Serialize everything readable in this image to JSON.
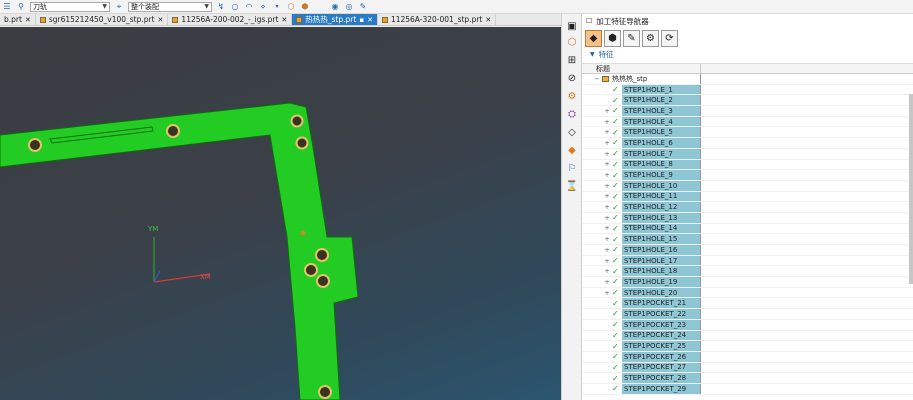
{
  "toolbar": {
    "filter_select": "刀轨",
    "assembly_select": "整个装配"
  },
  "tabs": [
    {
      "label": "b.prt",
      "active": false
    },
    {
      "label": "sgr615212450_v100_stp.prt",
      "active": false
    },
    {
      "label": "11256A-200-002_-_igs.prt",
      "active": false
    },
    {
      "label": "热热热_stp.prt",
      "active": true
    },
    {
      "label": "11256A-320-001_stp.prt",
      "active": false
    }
  ],
  "viewport": {
    "axis_y": "YM",
    "axis_x": "XM",
    "part_color": "#22cc22"
  },
  "navigator": {
    "title": "加工特征导航器",
    "section": "特征",
    "column_name": "标题",
    "root": "热热热_stp",
    "accent": "#8fc6d6",
    "items": [
      {
        "label": "STEP1HOLE_1",
        "expander": ""
      },
      {
        "label": "STEP1HOLE_2",
        "expander": ""
      },
      {
        "label": "STEP1HOLE_3",
        "expander": "+"
      },
      {
        "label": "STEP1HOLE_4",
        "expander": "+"
      },
      {
        "label": "STEP1HOLE_5",
        "expander": "+"
      },
      {
        "label": "STEP1HOLE_6",
        "expander": "+"
      },
      {
        "label": "STEP1HOLE_7",
        "expander": "+"
      },
      {
        "label": "STEP1HOLE_8",
        "expander": "+"
      },
      {
        "label": "STEP1HOLE_9",
        "expander": "+"
      },
      {
        "label": "STEP1HOLE_10",
        "expander": "+"
      },
      {
        "label": "STEP1HOLE_11",
        "expander": "+"
      },
      {
        "label": "STEP1HOLE_12",
        "expander": "+"
      },
      {
        "label": "STEP1HOLE_13",
        "expander": "+"
      },
      {
        "label": "STEP1HOLE_14",
        "expander": "+"
      },
      {
        "label": "STEP1HOLE_15",
        "expander": "+"
      },
      {
        "label": "STEP1HOLE_16",
        "expander": "+"
      },
      {
        "label": "STEP1HOLE_17",
        "expander": "+"
      },
      {
        "label": "STEP1HOLE_18",
        "expander": "+"
      },
      {
        "label": "STEP1HOLE_19",
        "expander": "+"
      },
      {
        "label": "STEP1HOLE_20",
        "expander": "+"
      },
      {
        "label": "STEP1POCKET_21",
        "expander": ""
      },
      {
        "label": "STEP1POCKET_22",
        "expander": ""
      },
      {
        "label": "STEP1POCKET_23",
        "expander": ""
      },
      {
        "label": "STEP1POCKET_24",
        "expander": ""
      },
      {
        "label": "STEP1POCKET_25",
        "expander": ""
      },
      {
        "label": "STEP1POCKET_26",
        "expander": ""
      },
      {
        "label": "STEP1POCKET_27",
        "expander": ""
      },
      {
        "label": "STEP1POCKET_28",
        "expander": ""
      },
      {
        "label": "STEP1POCKET_29",
        "expander": ""
      }
    ]
  }
}
